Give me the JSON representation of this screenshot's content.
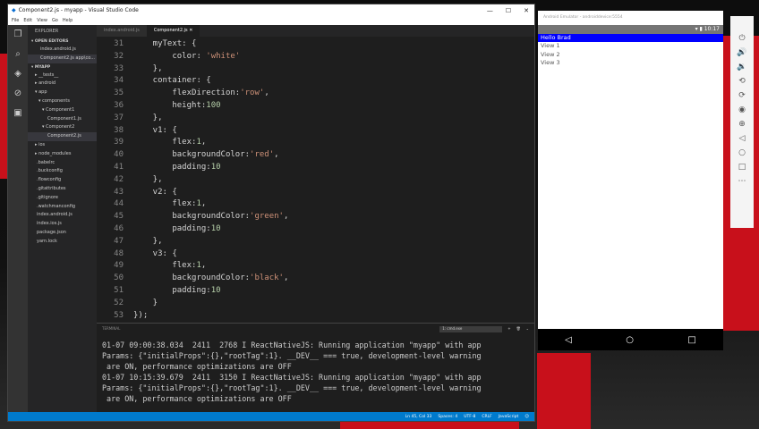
{
  "window": {
    "title": "Component2.js - myapp - Visual Studio Code",
    "min": "—",
    "max": "☐",
    "close": "✕"
  },
  "menu": [
    "File",
    "Edit",
    "View",
    "Go",
    "Help"
  ],
  "sidebar": {
    "title": "EXPLORER",
    "open_editors": "OPEN EDITORS",
    "open": [
      "index.android.js",
      "Component2.js  app\\co..."
    ],
    "project": "MYAPP",
    "tree": [
      "▸ __tests__",
      "▸ android",
      "▾ app",
      "▾ components",
      "▾ Component1",
      "Component1.js",
      "▾ Component2",
      "Component2.js",
      "▸ ios",
      "▸ node_modules",
      ".babelrc",
      ".buckconfig",
      ".flowconfig",
      ".gitattributes",
      ".gitignore",
      ".watchmanconfig",
      "index.android.js",
      "index.ios.js",
      "package.json",
      "yarn.lock"
    ]
  },
  "tabs": [
    "index.android.js",
    "Component2.js ✕"
  ],
  "code": [
    {
      "n": "31",
      "t": "    myText: {"
    },
    {
      "n": "32",
      "t": "        color: ",
      "s": "'white'"
    },
    {
      "n": "33",
      "t": "    },"
    },
    {
      "n": "34",
      "t": "    container: {"
    },
    {
      "n": "35",
      "t": "        flexDirection:",
      "s": "'row'",
      "e": ","
    },
    {
      "n": "36",
      "t": "        height:",
      "num": "100"
    },
    {
      "n": "37",
      "t": "    },"
    },
    {
      "n": "38",
      "t": "    v1: {"
    },
    {
      "n": "39",
      "t": "        flex:",
      "num": "1",
      "e": ","
    },
    {
      "n": "40",
      "t": "        backgroundColor:",
      "s": "'red'",
      "e": ","
    },
    {
      "n": "41",
      "t": "        padding:",
      "num": "10"
    },
    {
      "n": "42",
      "t": "    },"
    },
    {
      "n": "43",
      "t": "    v2: {"
    },
    {
      "n": "44",
      "t": "        flex:",
      "num": "1",
      "e": ","
    },
    {
      "n": "45",
      "t": "        backgroundColor:",
      "s": "'green'",
      "e": ","
    },
    {
      "n": "46",
      "t": "        padding:",
      "num": "10"
    },
    {
      "n": "47",
      "t": "    },"
    },
    {
      "n": "48",
      "t": "    v3: {"
    },
    {
      "n": "49",
      "t": "        flex:",
      "num": "1",
      "e": ","
    },
    {
      "n": "50",
      "t": "        backgroundColor:",
      "s": "'black'",
      "e": ","
    },
    {
      "n": "51",
      "t": "        padding:",
      "num": "10"
    },
    {
      "n": "52",
      "t": "    }"
    },
    {
      "n": "53",
      "t": "});"
    }
  ],
  "terminal": {
    "label": "TERMINAL",
    "select": "1: cmd.exe",
    "output": "01-07 09:00:38.034  2411  2768 I ReactNativeJS: Running application \"myapp\" with app\nParams: {\"initialProps\":{},\"rootTag\":1}. __DEV__ === true, development-level warning\n are ON, performance optimizations are OFF\n01-07 10:15:39.679  2411  3150 I ReactNativeJS: Running application \"myapp\" with app\nParams: {\"initialProps\":{},\"rootTag\":1}. __DEV__ === true, development-level warning\n are ON, performance optimizations are OFF"
  },
  "status": [
    "Ln 45, Col 33",
    "Spaces: 4",
    "UTF-8",
    "CRLF",
    "JavaScript"
  ],
  "emulator": {
    "title": "Android Emulator - androiddevice:5554",
    "time": "10:17",
    "hello": "Hello Brad",
    "views": [
      "View 1",
      "View 2",
      "View 3"
    ]
  }
}
